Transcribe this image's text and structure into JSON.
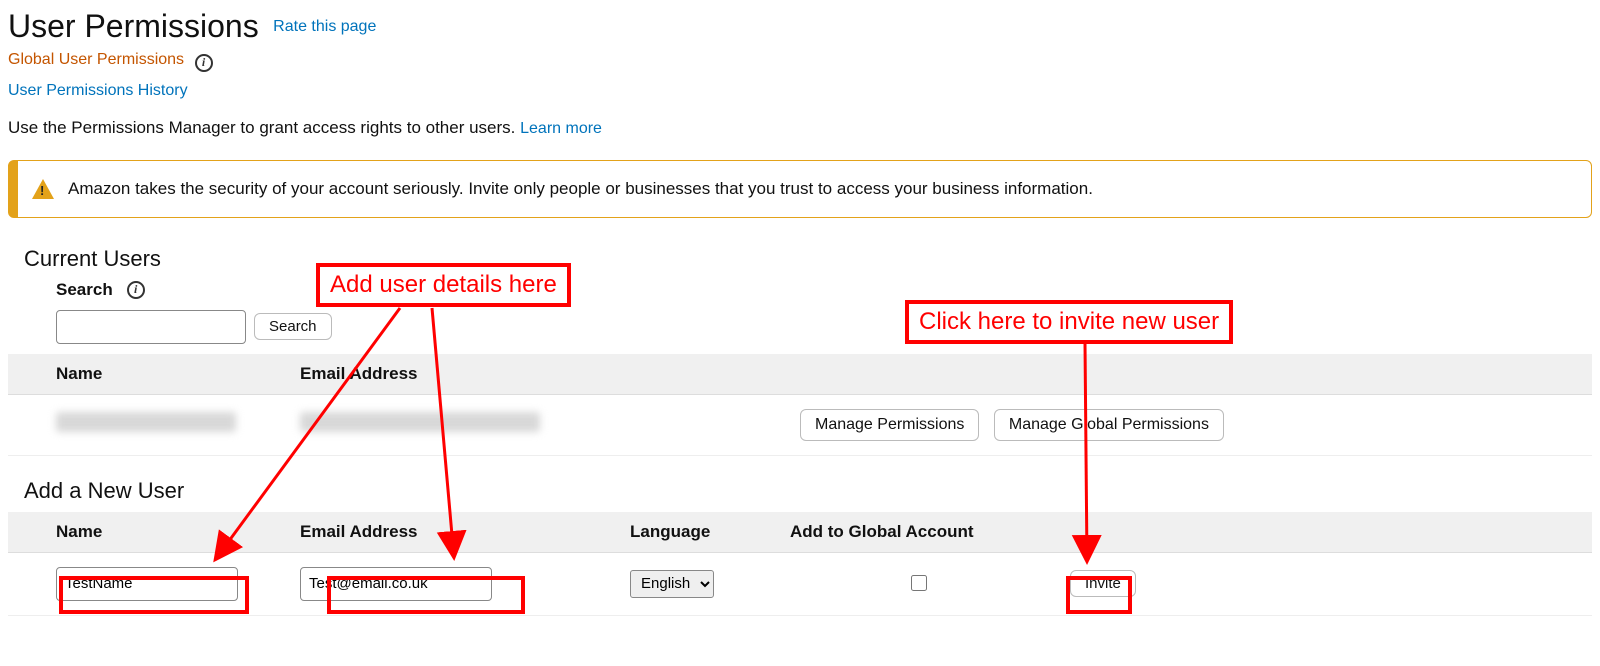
{
  "header": {
    "title": "User Permissions",
    "rate_link": "Rate this page",
    "global_link": "Global User Permissions",
    "history_link": "User Permissions History",
    "subtitle_prefix": "Use the Permissions Manager to grant access rights to other users. ",
    "learn_more": "Learn more"
  },
  "alert": {
    "text": "Amazon takes the security of your account seriously. Invite only people or businesses that you trust to access your business information."
  },
  "current_users": {
    "title": "Current Users",
    "search_label": "Search",
    "search_button": "Search",
    "columns": {
      "name": "Name",
      "email": "Email Address"
    },
    "row_actions": {
      "manage": "Manage Permissions",
      "manage_global": "Manage Global Permissions"
    }
  },
  "add_user": {
    "title": "Add a New User",
    "columns": {
      "name": "Name",
      "email": "Email Address",
      "language": "Language",
      "global": "Add to Global Account"
    },
    "name_value": "TestName",
    "email_value": "Test@email.co.uk",
    "language_value": "English",
    "invite_button": "Invite"
  },
  "annotations": {
    "add_details": "Add user details here",
    "invite_hint": "Click here to invite new user"
  }
}
